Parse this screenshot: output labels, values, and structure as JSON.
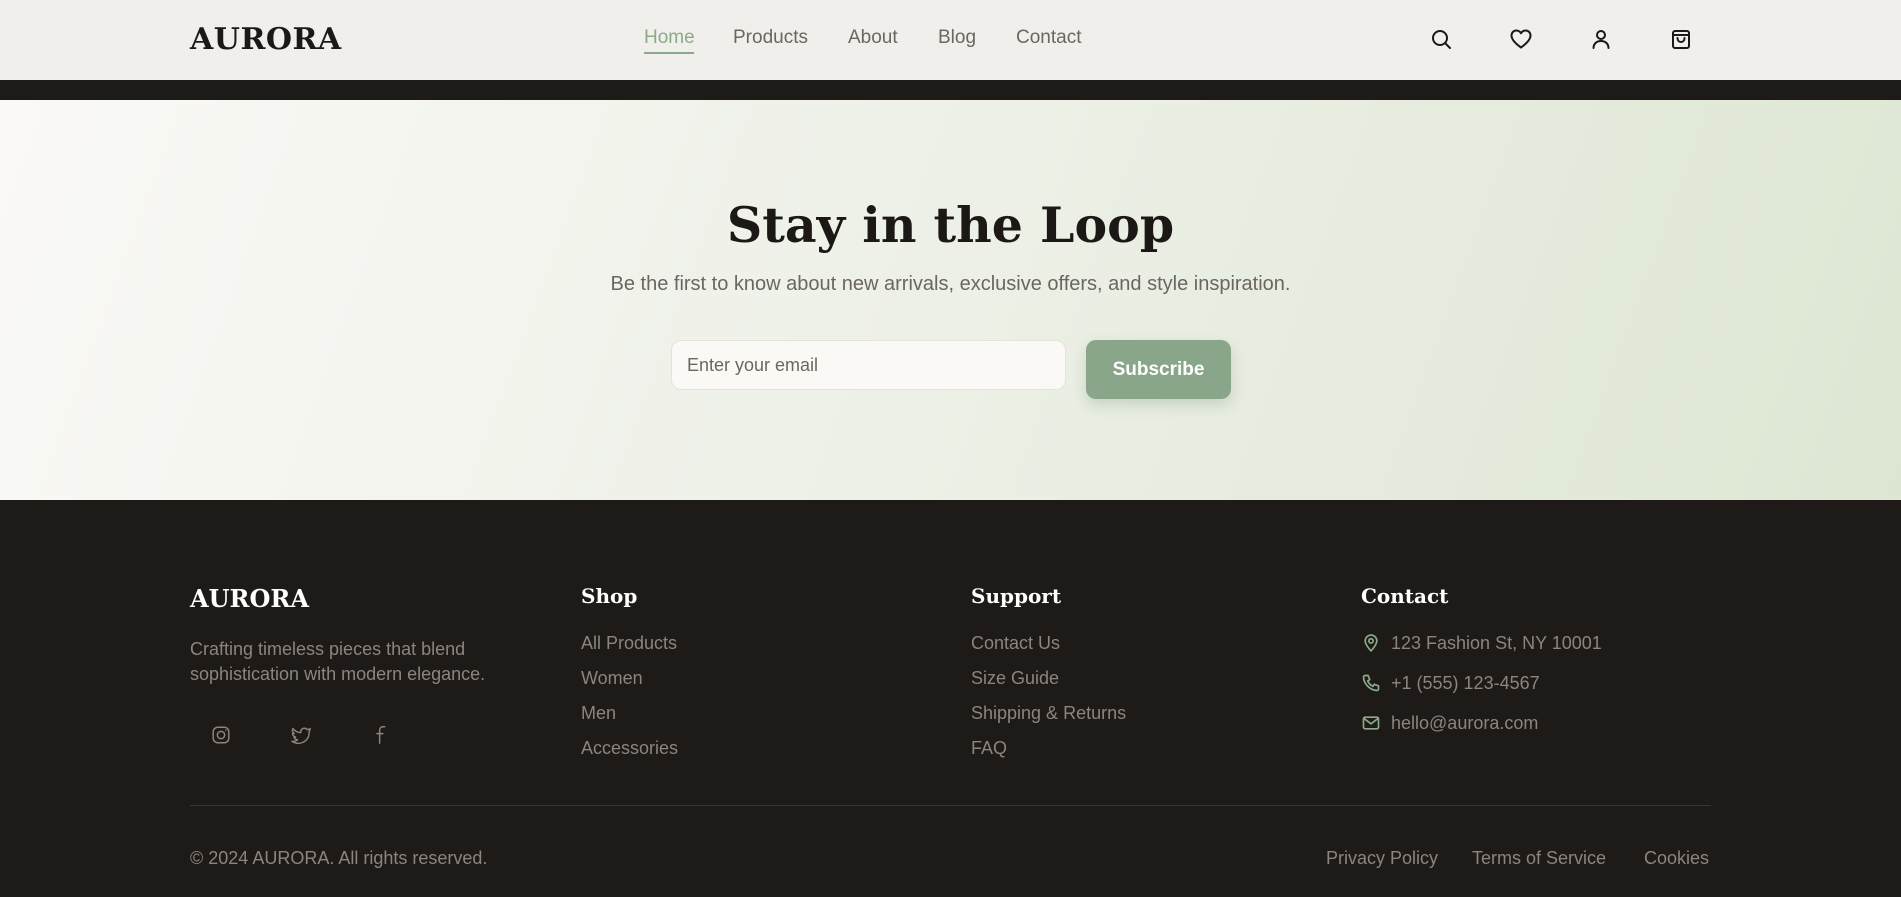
{
  "header": {
    "logo": "AURORA",
    "nav": [
      {
        "label": "Home",
        "active": true
      },
      {
        "label": "Products",
        "active": false
      },
      {
        "label": "About",
        "active": false
      },
      {
        "label": "Blog",
        "active": false
      },
      {
        "label": "Contact",
        "active": false
      }
    ],
    "icons": [
      "search-icon",
      "heart-icon",
      "user-icon",
      "shopping-bag-icon"
    ]
  },
  "newsletter": {
    "title": "Stay in the Loop",
    "subtitle": "Be the first to know about new arrivals, exclusive offers, and style inspiration.",
    "email_placeholder": "Enter your email",
    "email_value": "",
    "subscribe_label": "Subscribe"
  },
  "footer": {
    "logo": "AURORA",
    "tagline": "Crafting timeless pieces that blend sophistication with modern elegance.",
    "social": [
      "instagram-icon",
      "twitter-icon",
      "facebook-icon"
    ],
    "columns": [
      {
        "heading": "Shop",
        "links": [
          "All Products",
          "Women",
          "Men",
          "Accessories"
        ]
      },
      {
        "heading": "Support",
        "links": [
          "Contact Us",
          "Size Guide",
          "Shipping & Returns",
          "FAQ"
        ]
      }
    ],
    "contact": {
      "heading": "Contact",
      "items": [
        {
          "icon": "map-pin-icon",
          "text": "123 Fashion St, NY 10001"
        },
        {
          "icon": "phone-icon",
          "text": "+1 (555) 123-4567"
        },
        {
          "icon": "mail-icon",
          "text": "hello@aurora.com"
        }
      ]
    },
    "copyright": "© 2024 AURORA. All rights reserved.",
    "legal": [
      "Privacy Policy",
      "Terms of Service",
      "Cookies"
    ]
  },
  "colors": {
    "accent": "#8aa68a",
    "dark": "#1e1a18",
    "header_bg": "#f0efec",
    "muted_text": "#8a8580"
  }
}
